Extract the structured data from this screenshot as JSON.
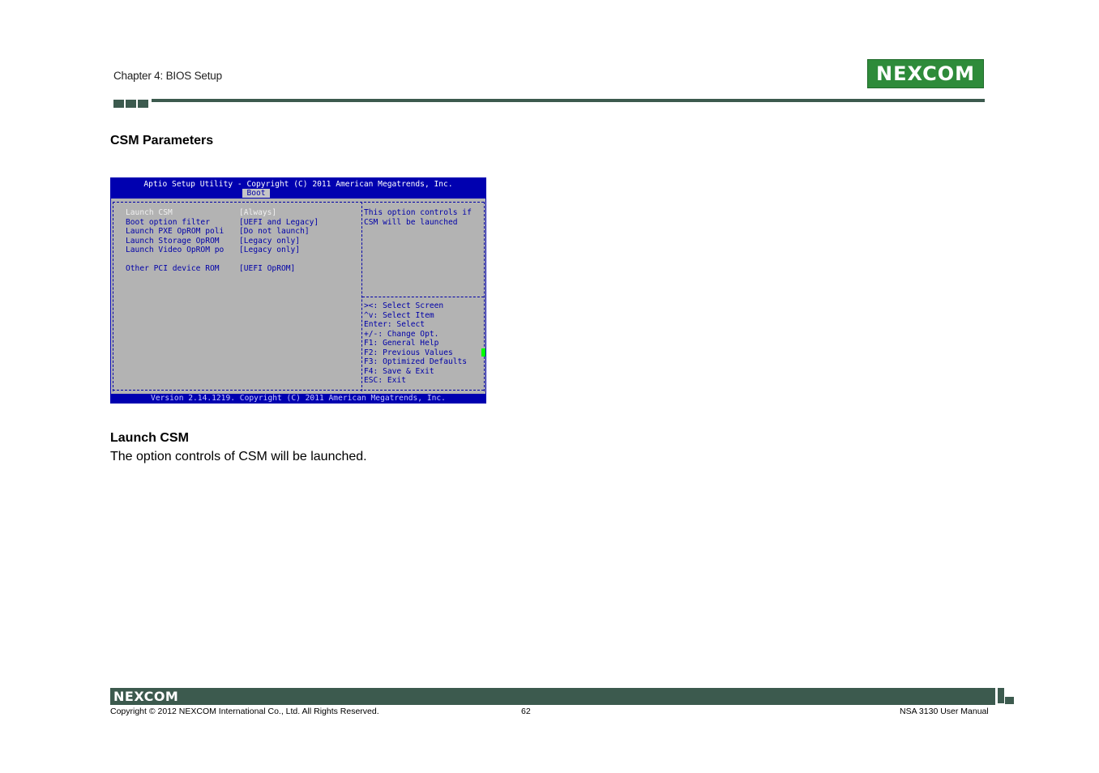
{
  "header": {
    "chapter": "Chapter 4: BIOS Setup",
    "logo": "NEXCOM"
  },
  "section": {
    "title": "CSM Parameters"
  },
  "bios": {
    "title": "Aptio Setup Utility - Copyright (C) 2011 American Megatrends, Inc.",
    "tab": "Boot",
    "items": [
      {
        "label": "Launch CSM",
        "value": "[Always]"
      },
      {
        "label": "Boot option filter",
        "value": "[UEFI and Legacy]"
      },
      {
        "label": "Launch PXE OpROM poli",
        "value": "[Do not launch]"
      },
      {
        "label": "Launch Storage OpROM",
        "value": "[Legacy only]"
      },
      {
        "label": "Launch Video OpROM po",
        "value": "[Legacy only]"
      },
      {
        "label": "Other PCI device ROM",
        "value": "[UEFI OpROM]"
      }
    ],
    "help": [
      "This option controls if",
      "CSM will be launched"
    ],
    "keys": [
      "><: Select Screen",
      "^v: Select Item",
      "Enter: Select",
      "+/-: Change Opt.",
      "F1: General Help",
      "F2: Previous Values",
      "F3: Optimized Defaults",
      "F4: Save & Exit",
      "ESC: Exit"
    ],
    "version": "Version 2.14.1219. Copyright (C) 2011 American Megatrends, Inc."
  },
  "launch_csm": {
    "title": "Launch CSM",
    "description": "The option controls of CSM will be launched."
  },
  "footer": {
    "logo": "NEXCOM",
    "copyright": "Copyright © 2012 NEXCOM International Co., Ltd. All Rights Reserved.",
    "page": "62",
    "manual": "NSA 3130 User Manual"
  },
  "colors": {
    "brand_green": "#2e8b3a",
    "bar_dark": "#3c5a4e",
    "bios_blue": "#0000b0",
    "bios_gray": "#b3b3b3"
  }
}
